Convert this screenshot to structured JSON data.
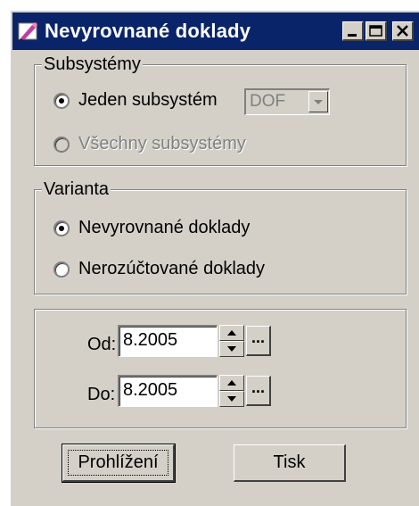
{
  "window": {
    "title": "Nevyrovnané doklady",
    "icon": "pencil-ruler-icon",
    "controls": [
      "minimize-icon",
      "maximize-icon",
      "close-icon"
    ]
  },
  "subsystemy": {
    "legend": "Subsystémy",
    "option_one": {
      "label": "Jeden subsystém",
      "selected": true
    },
    "option_all": {
      "label": "Všechny subsystémy",
      "selected": false,
      "disabled": true
    },
    "combo_value": "DOF"
  },
  "varianta": {
    "legend": "Varianta",
    "option_nevyrovnane": {
      "label": "Nevyrovnané doklady",
      "selected": true
    },
    "option_nerozuctovane": {
      "label": "Nerozúčtované doklady",
      "selected": false
    }
  },
  "period": {
    "od_label": "Od:",
    "od_value": "8.2005",
    "do_label": "Do:",
    "do_value": "8.2005",
    "picker_label": "..."
  },
  "buttons": {
    "view_label": "Prohlížení",
    "print_label": "Tisk"
  },
  "colors": {
    "titlebar": "#0a246a",
    "face": "#d4d0c8",
    "disabled_text": "#808080"
  }
}
